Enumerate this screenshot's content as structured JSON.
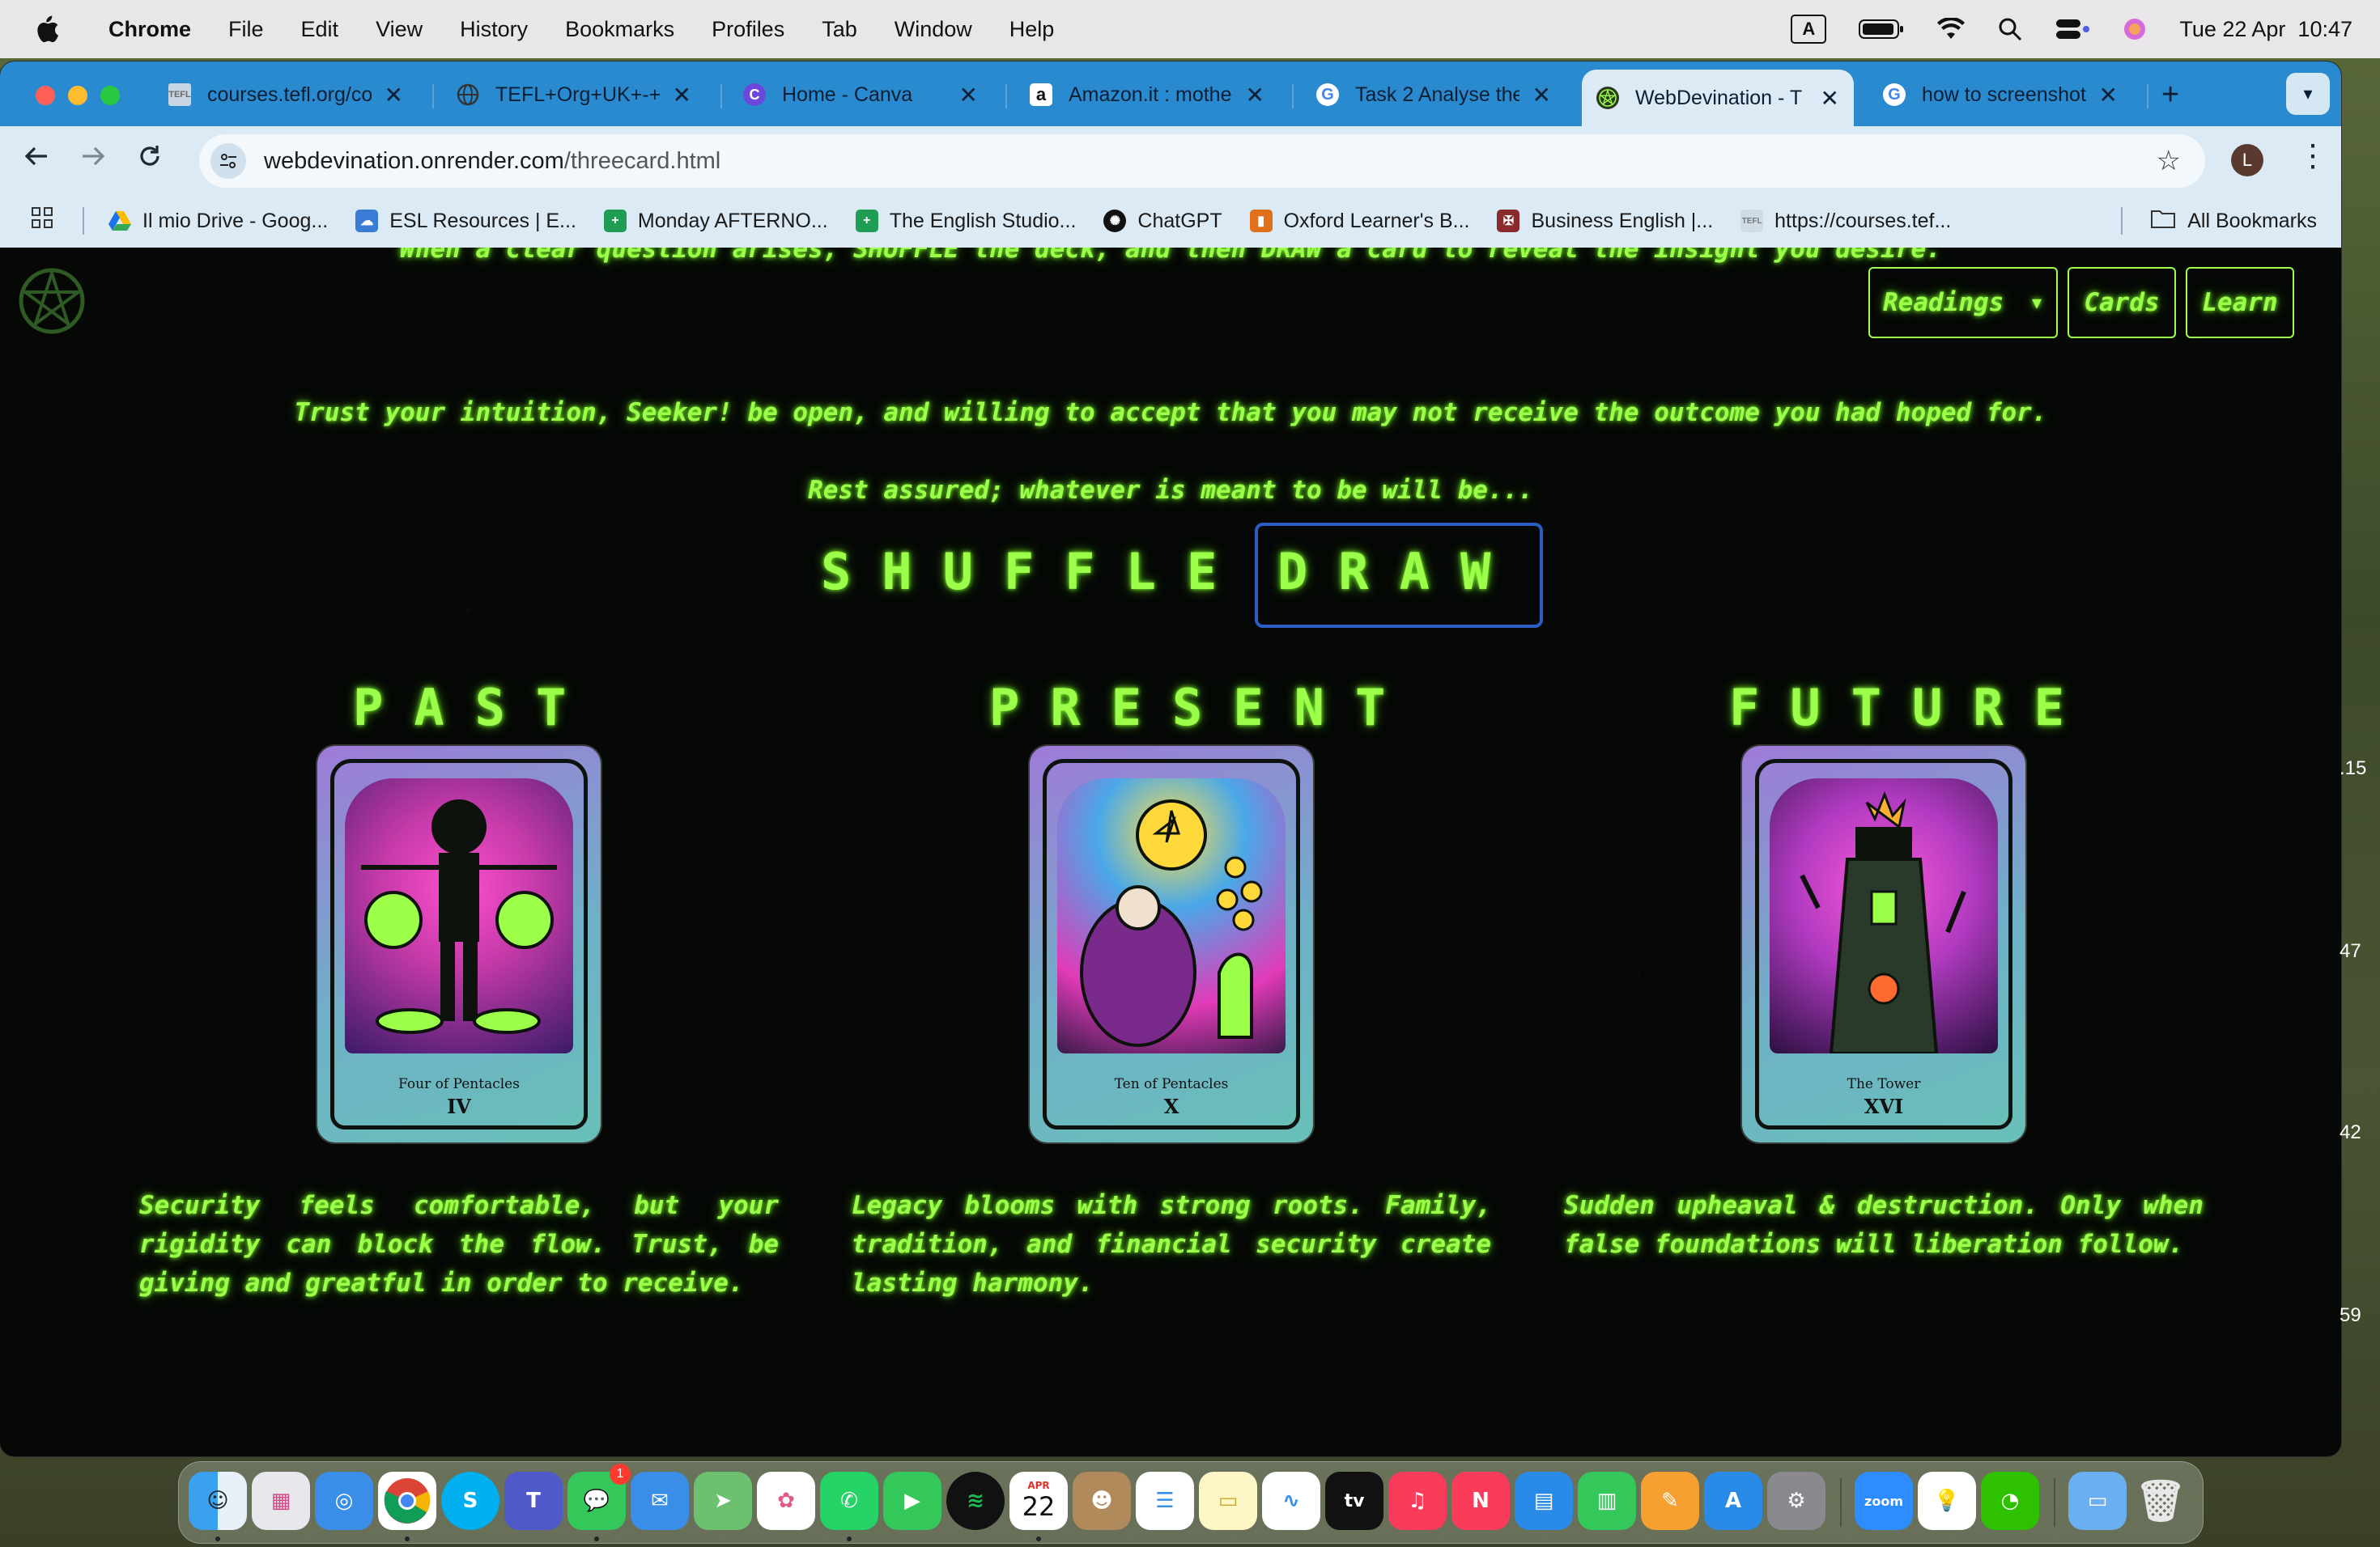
{
  "menubar": {
    "app": "Chrome",
    "items": [
      "File",
      "Edit",
      "View",
      "History",
      "Bookmarks",
      "Profiles",
      "Tab",
      "Window",
      "Help"
    ],
    "input_indicator": "A",
    "datetime": "Tue 22 Apr  10:47"
  },
  "tabs": [
    {
      "title": "courses.tefl.org/co",
      "favicon": "TEFL",
      "favicon_color": "#6a6a6a"
    },
    {
      "title": "TEFL+Org+UK+-+I",
      "favicon": "globe-icon",
      "favicon_color": "#444444"
    },
    {
      "title": "Home - Canva",
      "favicon": "C",
      "favicon_color": "#6b47dc"
    },
    {
      "title": "Amazon.it : mother",
      "favicon": "a",
      "favicon_color": "#111111"
    },
    {
      "title": "Task 2 Analyse the",
      "favicon": "G",
      "favicon_color": "#ffffff"
    },
    {
      "title": "WebDevination - T",
      "favicon": "pentacle-icon",
      "favicon_color": "#2a3a1a",
      "active": true
    },
    {
      "title": "how to screenshot",
      "favicon": "G",
      "favicon_color": "#ffffff"
    }
  ],
  "toolbar": {
    "url_host": "webdevination.onrender.com",
    "url_path": "/threecard.html",
    "avatar_letter": "L"
  },
  "bookmarks": [
    {
      "label": "Il mio Drive - Goog...",
      "icon_color": "#1a73e8"
    },
    {
      "label": "ESL Resources | E...",
      "icon_color": "#3a7bd5"
    },
    {
      "label": "Monday AFTERNO...",
      "icon_color": "#1f9d55"
    },
    {
      "label": "The English Studio...",
      "icon_color": "#1f9d55"
    },
    {
      "label": "ChatGPT",
      "icon_color": "#111111"
    },
    {
      "label": "Oxford Learner's B...",
      "icon_color": "#e0701a"
    },
    {
      "label": "Business English |...",
      "icon_color": "#8a2a2a"
    },
    {
      "label": "https://courses.tef...",
      "icon_color": "#777777"
    }
  ],
  "all_bookmarks": "All Bookmarks",
  "site": {
    "nav": {
      "readings": "Readings",
      "cards": "Cards",
      "learn": "Learn"
    },
    "intro_line1": "When a clear question arises, SHUFFLE the deck, and then DRAW a card to reveal the insight you desire.",
    "intro_line2": "Trust your intuition, Seeker! be open, and willing to accept that you may not receive the outcome you had hoped for.",
    "intro_line3": "Rest assured; whatever is meant to be will be...",
    "shuffle": "SHUFFLE",
    "draw": "DRAW",
    "columns": [
      {
        "title": "PAST",
        "card_name": "Four of Pentacles",
        "card_numeral": "IV",
        "text": "Security feels comfortable, but your rigidity can block the flow. Trust, be giving and greatful in order to receive."
      },
      {
        "title": "PRESENT",
        "card_name": "Ten of Pentacles",
        "card_numeral": "X",
        "text": "Legacy blooms with strong roots. Family, tradition, and financial security create lasting harmony."
      },
      {
        "title": "FUTURE",
        "card_name": "The Tower",
        "card_numeral": "XVI",
        "text": "Sudden upheaval & destruction. Only when false foundations will liberation follow."
      }
    ]
  },
  "desktop_edge_numbers": [
    ".15",
    "47",
    "42",
    "59"
  ],
  "dock": {
    "calendar_month": "APR",
    "calendar_day": "22",
    "messages_badge": "1",
    "zoom_label": "zoom",
    "tv_label": "tv"
  }
}
